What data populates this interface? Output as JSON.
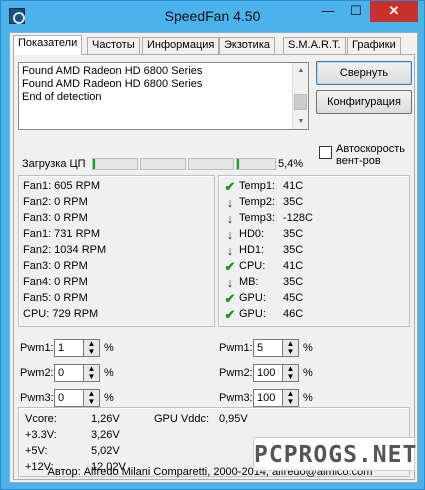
{
  "window": {
    "title": "SpeedFan 4.50",
    "controls": {
      "minimize": "—",
      "maximize": "☐",
      "close": "✕"
    }
  },
  "tabs": [
    "Показатели",
    "Частоты",
    "Информация",
    "Экзотика",
    "S.M.A.R.T.",
    "Графики"
  ],
  "log": {
    "lines": [
      "Found AMD Radeon HD 6800 Series",
      "Found AMD Radeon HD 6800 Series",
      "End of detection"
    ]
  },
  "buttons": {
    "minimize": "Свернуть",
    "config": "Конфигурация"
  },
  "auto_fan": {
    "label": "Автоскорость вент-ров",
    "checked": false
  },
  "cpu_load": {
    "label": "Загрузка ЦП",
    "value": "5,4%",
    "bars": [
      0.04,
      0,
      0,
      0.06
    ]
  },
  "fans": [
    "Fan1: 605 RPM",
    "Fan2: 0 RPM",
    "Fan3: 0 RPM",
    "Fan1: 731 RPM",
    "Fan2: 1034 RPM",
    "Fan3: 0 RPM",
    "Fan4: 0 RPM",
    "Fan5: 0 RPM",
    "CPU:  729 RPM"
  ],
  "temps": [
    {
      "name": "Temp1:",
      "value": "41C",
      "status": "ok"
    },
    {
      "name": "Temp2:",
      "value": "35C",
      "status": "down"
    },
    {
      "name": "Temp3:",
      "value": "-128C",
      "status": "down"
    },
    {
      "name": "HD0:",
      "value": "35C",
      "status": "down"
    },
    {
      "name": "HD1:",
      "value": "35C",
      "status": "down"
    },
    {
      "name": "CPU:",
      "value": "41C",
      "status": "ok"
    },
    {
      "name": "MB:",
      "value": "35C",
      "status": "down"
    },
    {
      "name": "GPU:",
      "value": "45C",
      "status": "ok"
    },
    {
      "name": "GPU:",
      "value": "46C",
      "status": "ok"
    }
  ],
  "pwm_left": [
    {
      "label": "Pwm1:",
      "value": "1"
    },
    {
      "label": "Pwm2:",
      "value": "0"
    },
    {
      "label": "Pwm3:",
      "value": "0"
    }
  ],
  "pwm_right": [
    {
      "label": "Pwm1:",
      "value": "5"
    },
    {
      "label": "Pwm2:",
      "value": "100"
    },
    {
      "label": "Pwm3:",
      "value": "100"
    }
  ],
  "percent": "%",
  "voltages": [
    {
      "name": "Vcore:",
      "value": "1,26V"
    },
    {
      "name": "+3.3V:",
      "value": "3,26V"
    },
    {
      "name": "+5V:",
      "value": "5,02V"
    },
    {
      "name": "+12V:",
      "value": "12,02V"
    },
    {
      "name": "GPU Vddc:",
      "value": "0,95V"
    }
  ],
  "gpu_vddc": {
    "name": "GPU Vddc:",
    "value": "0,95V"
  },
  "footer": "Автор: Alfredo Milani Comparetti, 2000-2014, alfredo@almico.com",
  "watermark": "PCPROGS.NET"
}
